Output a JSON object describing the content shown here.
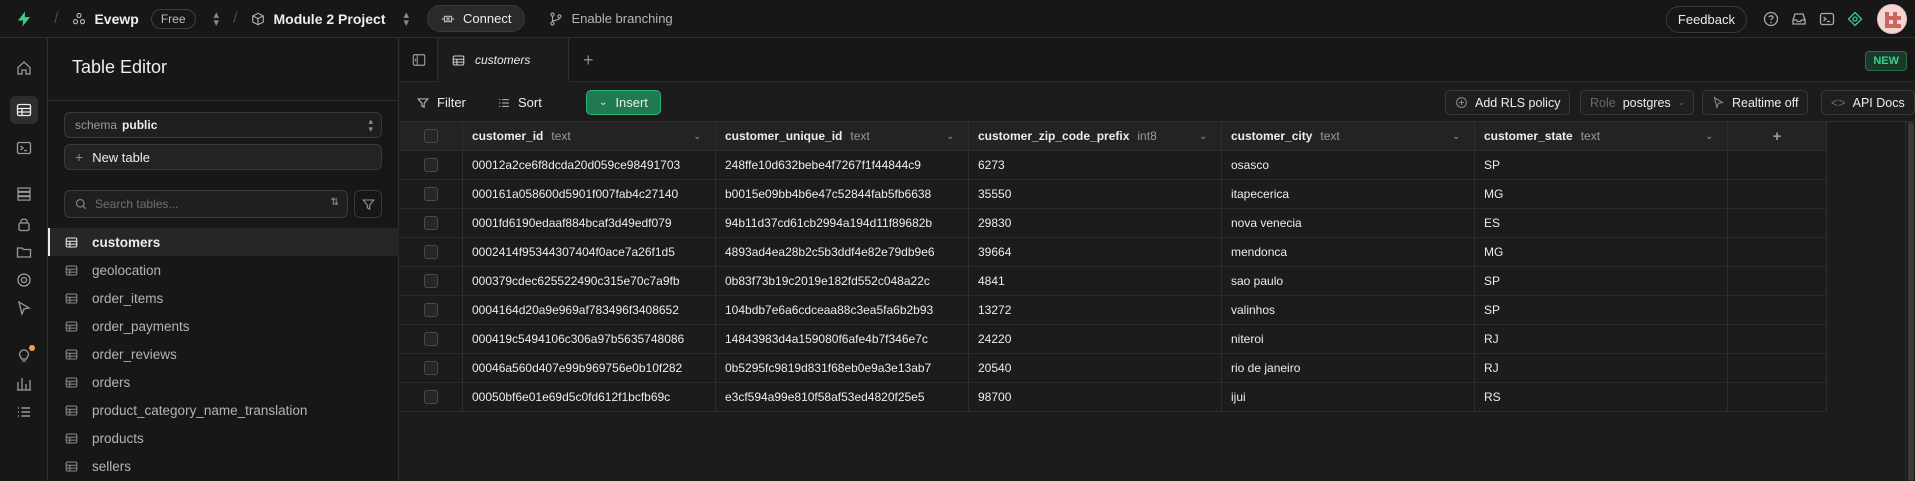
{
  "topbar": {
    "org": "Evewp",
    "plan": "Free",
    "project": "Module 2 Project",
    "connect_label": "Connect",
    "branching_label": "Enable branching",
    "feedback_label": "Feedback"
  },
  "sidebar": {
    "title": "Table Editor",
    "schema_key": "schema",
    "schema_value": "public",
    "new_table_label": "New table",
    "search_placeholder": "Search tables...",
    "tables": [
      {
        "label": "customers",
        "active": true
      },
      {
        "label": "geolocation"
      },
      {
        "label": "order_items"
      },
      {
        "label": "order_payments"
      },
      {
        "label": "order_reviews"
      },
      {
        "label": "orders"
      },
      {
        "label": "product_category_name_translation"
      },
      {
        "label": "products"
      },
      {
        "label": "sellers"
      }
    ]
  },
  "tabs": {
    "active_tab": "customers",
    "new_badge": "NEW"
  },
  "toolbar": {
    "filter_label": "Filter",
    "sort_label": "Sort",
    "insert_label": "Insert",
    "add_rls_label": "Add RLS policy",
    "role_label": "Role",
    "role_value": "postgres",
    "realtime_label": "Realtime off",
    "api_docs_label": "API Docs"
  },
  "grid": {
    "columns": [
      {
        "name": "customer_id",
        "type": "text"
      },
      {
        "name": "customer_unique_id",
        "type": "text"
      },
      {
        "name": "customer_zip_code_prefix",
        "type": "int8"
      },
      {
        "name": "customer_city",
        "type": "text"
      },
      {
        "name": "customer_state",
        "type": "text"
      }
    ],
    "rows": [
      [
        "00012a2ce6f8dcda20d059ce98491703",
        "248ffe10d632bebe4f7267f1f44844c9",
        "6273",
        "osasco",
        "SP"
      ],
      [
        "000161a058600d5901f007fab4c27140",
        "b0015e09bb4b6e47c52844fab5fb6638",
        "35550",
        "itapecerica",
        "MG"
      ],
      [
        "0001fd6190edaaf884bcaf3d49edf079",
        "94b11d37cd61cb2994a194d11f89682b",
        "29830",
        "nova venecia",
        "ES"
      ],
      [
        "0002414f95344307404f0ace7a26f1d5",
        "4893ad4ea28b2c5b3ddf4e82e79db9e6",
        "39664",
        "mendonca",
        "MG"
      ],
      [
        "000379cdec625522490c315e70c7a9fb",
        "0b83f73b19c2019e182fd552c048a22c",
        "4841",
        "sao paulo",
        "SP"
      ],
      [
        "0004164d20a9e969af783496f3408652",
        "104bdb7e6a6cdceaa88c3ea5fa6b2b93",
        "13272",
        "valinhos",
        "SP"
      ],
      [
        "000419c5494106c306a97b5635748086",
        "14843983d4a159080f6afe4b7f346e7c",
        "24220",
        "niteroi",
        "RJ"
      ],
      [
        "00046a560d407e99b969756e0b10f282",
        "0b5295fc9819d831f68eb0e9a3e13ab7",
        "20540",
        "rio de janeiro",
        "RJ"
      ],
      [
        "00050bf6e01e69d5c0fd612f1bcfb69c",
        "e3cf594a99e810f58af53ed4820f25e5",
        "98700",
        "ijui",
        "RS"
      ]
    ]
  },
  "colors": {
    "accent": "#3ecf8e",
    "insert_bg": "#1f7a51",
    "background": "#1c1c1c"
  }
}
